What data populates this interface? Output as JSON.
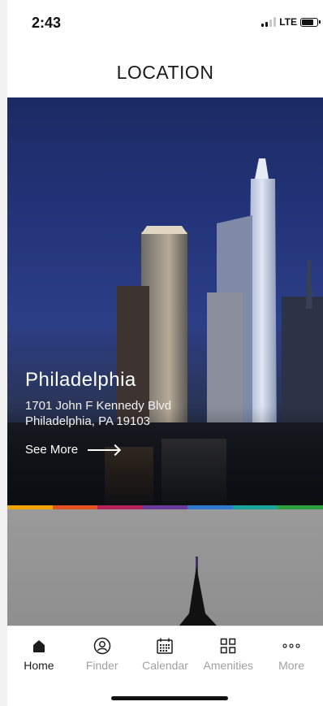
{
  "status_bar": {
    "time": "2:43",
    "network": "LTE",
    "battery_level": 0.8
  },
  "header": {
    "title": "LOCATION"
  },
  "location_card": {
    "city": "Philadelphia",
    "address_line1": "1701 John F Kennedy Blvd",
    "address_line2": "Philadelphia, PA 19103",
    "see_more_label": "See More"
  },
  "accent_stripe_colors": [
    "#f2a400",
    "#e2531f",
    "#b8235a",
    "#6a3b9a",
    "#2f7ad0",
    "#1aa39a",
    "#2e9f3e"
  ],
  "tabs": [
    {
      "label": "Home",
      "icon": "home-icon",
      "active": true
    },
    {
      "label": "Finder",
      "icon": "person-circle-icon",
      "active": false
    },
    {
      "label": "Calendar",
      "icon": "calendar-icon",
      "active": false
    },
    {
      "label": "Amenities",
      "icon": "grid-icon",
      "active": false
    },
    {
      "label": "More",
      "icon": "more-dots-icon",
      "active": false
    }
  ]
}
